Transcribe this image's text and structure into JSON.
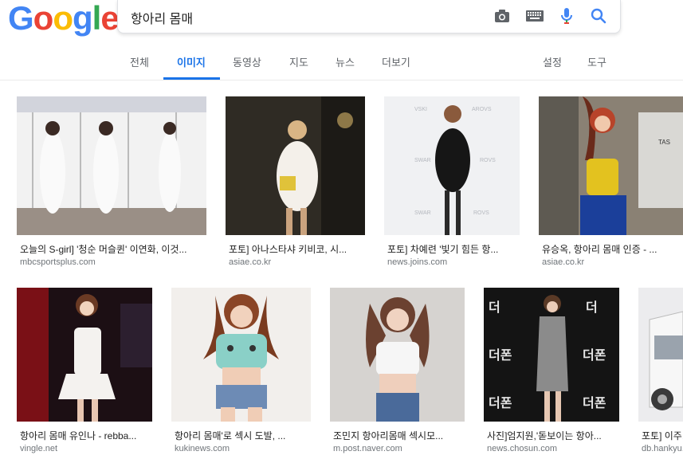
{
  "logo": {
    "text": [
      "G",
      "o",
      "o",
      "g",
      "l",
      "e"
    ],
    "colors": [
      "#4285F4",
      "#EA4335",
      "#FBBC05",
      "#4285F4",
      "#34A853",
      "#EA4335"
    ]
  },
  "search": {
    "query": "항아리 몸매"
  },
  "icons": {
    "camera": "camera-icon",
    "keyboard": "keyboard-icon",
    "mic": "mic-icon",
    "search": "search-icon"
  },
  "tabs": {
    "all": "전체",
    "images": "이미지",
    "videos": "동영상",
    "maps": "지도",
    "news": "뉴스",
    "more": "더보기",
    "settings": "설정",
    "tools": "도구"
  },
  "results": [
    {
      "caption": "오늘의 S-girl] '청순 머슬퀸' 이연화, 이것...",
      "source": "mbcsportsplus.com",
      "bg": "#c9ccd6",
      "fg": "#f3f3f3"
    },
    {
      "caption": "포토] 아나스타샤 키비코, 시...",
      "source": "asiae.co.kr",
      "bg": "#2a2620",
      "fg": "#f4f0ea"
    },
    {
      "caption": "포토] 차예련 '빛기 힘든 항...",
      "source": "news.joins.com",
      "bg": "#eef0f2",
      "fg": "#151515"
    },
    {
      "caption": "유승옥, 항아리 몸매 인증 - ...",
      "source": "asiae.co.kr",
      "bg": "#7e7466",
      "fg": "#e3c21f"
    },
    {
      "caption": "항아리 몸매 유인나 - rebba...",
      "source": "vingle.net",
      "bg": "#1e0f12",
      "fg": "#ecebe8"
    },
    {
      "caption": "항아리 몸매'로 섹시 도발, ...",
      "source": "kukinews.com",
      "bg": "#f4f1ee",
      "fg": "#8ad0c7"
    },
    {
      "caption": "조민지 항아리몸매 섹시모...",
      "source": "m.post.naver.com",
      "bg": "#d8d5d2",
      "fg": "#f2f2f2"
    },
    {
      "caption": "사진]엄지원,'돋보이는 항아...",
      "source": "news.chosun.com",
      "bg": "#151515",
      "fg": "#8b8b8b"
    },
    {
      "caption": "포토] 이주...",
      "source": "db.hankyu...",
      "bg": "#e8e8ea",
      "fg": "#3a3a3a"
    }
  ]
}
